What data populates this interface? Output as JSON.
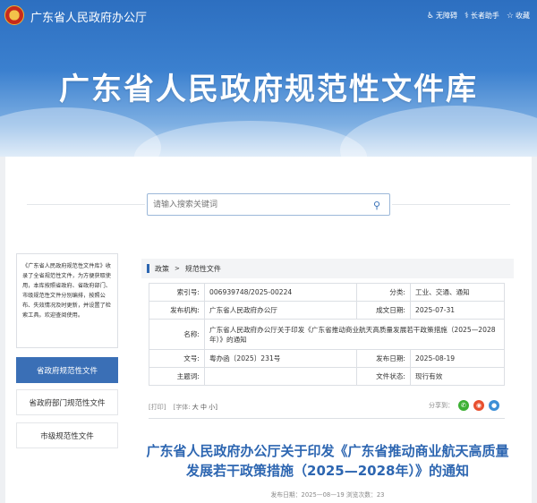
{
  "header": {
    "site_title": "广东省人民政府办公厅",
    "tools": [
      {
        "icon": "accessibility-icon",
        "label": "无障碍"
      },
      {
        "icon": "elder-helper-icon",
        "label": "长者助手"
      },
      {
        "icon": "star-icon",
        "label": "收藏"
      }
    ],
    "banner_title": "广东省人民政府规范性文件库"
  },
  "search": {
    "placeholder": "请输入搜索关键词"
  },
  "sidebar": {
    "intro": "《广东省人民政府规范性文件库》收录了全省规范性文件，为方便获取使用，本库按照省政府、省政府部门、市级规范性文件分别编排，按照公布、失效情况及时更新，并设置了检索工具。欢迎查阅使用。",
    "items": [
      {
        "label": "省政府规范性文件",
        "active": true
      },
      {
        "label": "省政府部门规范性文件",
        "active": false
      },
      {
        "label": "市级规范性文件",
        "active": false
      }
    ]
  },
  "breadcrumb": {
    "items": [
      "政策",
      "规范性文件"
    ]
  },
  "meta": {
    "index_label": "索引号:",
    "index_value": "006939748/2025-00224",
    "category_label": "分类:",
    "category_value": "工业、交通、通知",
    "issuer_label": "发布机构:",
    "issuer_value": "广东省人民政府办公厅",
    "created_label": "成文日期:",
    "created_value": "2025-07-31",
    "name_label": "名称:",
    "name_value": "广东省人民政府办公厅关于印发《广东省推动商业航天高质量发展若干政策措施（2025—2028年）》的通知",
    "docno_label": "文号:",
    "docno_value": "粤办函〔2025〕231号",
    "pubdate_label": "发布日期:",
    "pubdate_value": "2025-08-19",
    "subject_label": "主题词:",
    "subject_value": "",
    "status_label": "文件状态:",
    "status_value": "现行有效"
  },
  "doc_tools": {
    "print": "[打印]",
    "font_label": "[字体:",
    "font_large": "大",
    "font_medium": "中",
    "font_small": "小]",
    "share_label": "分享到："
  },
  "document": {
    "title": "广东省人民政府办公厅关于印发《广东省推动商业航天高质量发展若干政策措施（2025—2028年）》的通知",
    "pubinfo": "发布日期：2025—08—19  浏览次数：23"
  },
  "colors": {
    "accent": "#2d66b1",
    "active_nav": "#3a6fb6",
    "wechat": "#3cb034",
    "weibo": "#e8502f",
    "other_share": "#3d8fd6"
  }
}
